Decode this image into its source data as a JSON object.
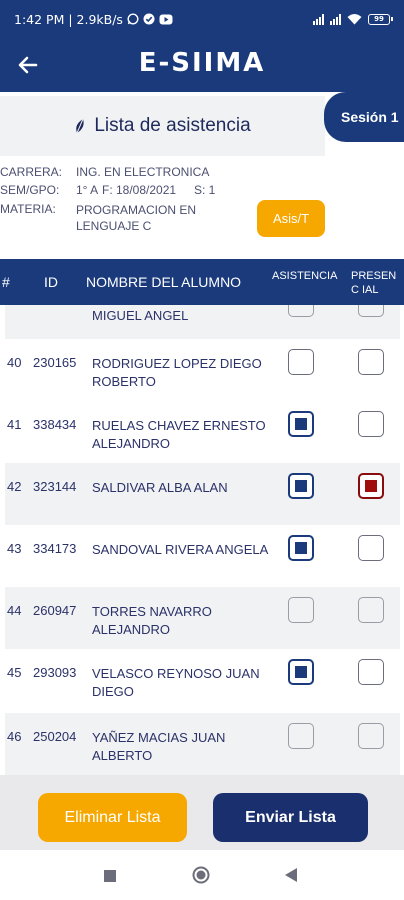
{
  "status_bar": {
    "time_speed": "1:42 PM | 2.9kB/s",
    "battery": "99"
  },
  "app_bar": {
    "logo": "E-SIIMA"
  },
  "header": {
    "title": "Lista de asistencia",
    "session": "Sesión 1"
  },
  "info": {
    "carrera_label": "CARRERA:",
    "carrera_value": "ING. EN ELECTRONICA",
    "semgpo_label": "SEM/GPO:",
    "semgpo_value": "1° A",
    "fecha": "F: 18/08/2021",
    "sesion": "S: 1",
    "materia_label": "MATERIA:",
    "materia_value": "PROGRAMACION EN LENGUAJE C",
    "asis_button": "Asis/T"
  },
  "table": {
    "headers": {
      "num": "#",
      "id": "ID",
      "name": "NOMBRE DEL ALUMNO",
      "asistencia": "ASISTENCIA",
      "presencial": "PRESENC IAL"
    },
    "partial_name": "MIGUEL ANGEL",
    "rows": [
      {
        "num": "40",
        "id": "230165",
        "name": "RODRIGUEZ LOPEZ DIEGO ROBERTO"
      },
      {
        "num": "41",
        "id": "338434",
        "name": "RUELAS CHAVEZ ERNESTO ALEJANDRO"
      },
      {
        "num": "42",
        "id": "323144",
        "name": "SALDIVAR ALBA ALAN"
      },
      {
        "num": "43",
        "id": "334173",
        "name": "SANDOVAL RIVERA ANGELA"
      },
      {
        "num": "44",
        "id": "260947",
        "name": "TORRES NAVARRO ALEJANDRO"
      },
      {
        "num": "45",
        "id": "293093",
        "name": "VELASCO REYNOSO JUAN DIEGO"
      },
      {
        "num": "46",
        "id": "250204",
        "name": "YAÑEZ MACIAS JUAN ALBERTO"
      }
    ]
  },
  "footer": {
    "delete_label": "Eliminar Lista",
    "send_label": "Enviar Lista"
  },
  "colors": {
    "primary": "#1a3a7c",
    "accent": "#f6a800",
    "presencial_checked": "#a00d0d"
  }
}
